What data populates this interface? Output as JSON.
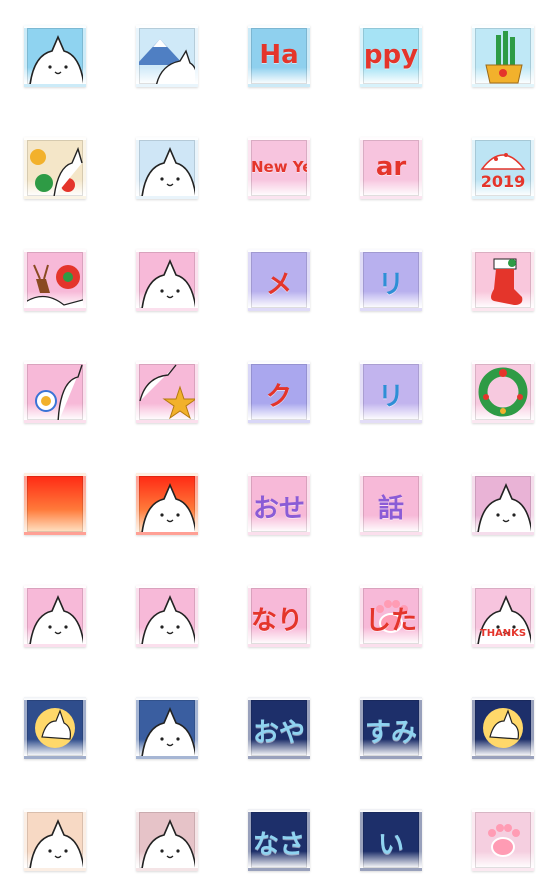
{
  "sheet": {
    "rows": [
      [
        {
          "name": "cat-sunrise-tile",
          "bg": "#8fd3f0",
          "icon": "cat-face-icon",
          "text": ""
        },
        {
          "name": "cat-mount-fuji-tile",
          "bg": "#cfe9f8",
          "icon": "mount-fuji-icon",
          "text": ""
        },
        {
          "name": "happy-ha-tile",
          "bg": "#8fd0ee",
          "icon": "",
          "text": "Ha"
        },
        {
          "name": "happy-ppy-tile",
          "bg": "#a6e3f5",
          "icon": "",
          "text": "ppy"
        },
        {
          "name": "kadomatsu-tile",
          "bg": "#bfe8f6",
          "icon": "kadomatsu-icon",
          "text": ""
        }
      ],
      [
        {
          "name": "cat-paint-tile",
          "bg": "#f4e6c8",
          "icon": "paint-splash-icon",
          "text": ""
        },
        {
          "name": "cat-paint-2-tile",
          "bg": "#cfe6f6",
          "icon": "cat-face-icon",
          "text": ""
        },
        {
          "name": "new-year-tile",
          "bg": "#f7c4de",
          "icon": "",
          "text": "New Ye"
        },
        {
          "name": "new-year-2-tile",
          "bg": "#f7c4de",
          "icon": "",
          "text": "ar"
        },
        {
          "name": "2019-tile",
          "bg": "#bde4f4",
          "icon": "fan-icon",
          "text": "2019"
        }
      ],
      [
        {
          "name": "reindeer-tile",
          "bg": "#f7b9d8",
          "icon": "reindeer-icon",
          "text": ""
        },
        {
          "name": "cat-christmas-tile",
          "bg": "#f7b9d8",
          "icon": "cat-face-icon",
          "text": ""
        },
        {
          "name": "merry-me-tile",
          "bg": "#b8b0ee",
          "icon": "",
          "text": "メ"
        },
        {
          "name": "merry-ri-tile",
          "bg": "#b8b0ee",
          "icon": "",
          "text": "リ"
        },
        {
          "name": "stocking-tile",
          "bg": "#f9c7dc",
          "icon": "stocking-icon",
          "text": ""
        }
      ],
      [
        {
          "name": "cat-ornament-tile",
          "bg": "#f7b9d8",
          "icon": "ornament-icon",
          "text": ""
        },
        {
          "name": "cat-star-tile",
          "bg": "#f7b9d8",
          "icon": "star-icon",
          "text": ""
        },
        {
          "name": "christmas-ku-tile",
          "bg": "#aaa7ee",
          "icon": "",
          "text": "ク"
        },
        {
          "name": "christmas-ri-tile",
          "bg": "#c2b4ee",
          "icon": "",
          "text": "リ"
        },
        {
          "name": "wreath-tile",
          "bg": "#f7c9df",
          "icon": "wreath-icon",
          "text": ""
        }
      ],
      [
        {
          "name": "sunrise-red-tile",
          "bg": "#ff3a1c",
          "icon": "",
          "text": ""
        },
        {
          "name": "sunrise-cat-tile",
          "bg": "#ff3a1c",
          "icon": "cat-face-icon",
          "text": ""
        },
        {
          "name": "thanks-ose-tile",
          "bg": "#f7b9d8",
          "icon": "",
          "text": "おせ"
        },
        {
          "name": "thanks-wa-tile",
          "bg": "#f7b9d8",
          "icon": "",
          "text": "話"
        },
        {
          "name": "cat-peek-tile",
          "bg": "#e9b3d6",
          "icon": "cat-face-icon",
          "text": ""
        }
      ],
      [
        {
          "name": "cat-bow-tile",
          "bg": "#f7b9d8",
          "icon": "cat-face-icon",
          "text": ""
        },
        {
          "name": "cat-bow-2-tile",
          "bg": "#f7b9d8",
          "icon": "cat-face-icon",
          "text": ""
        },
        {
          "name": "narima-tile",
          "bg": "#f7b9d8",
          "icon": "",
          "text": "なりま"
        },
        {
          "name": "shita-tile",
          "bg": "#f7b9d8",
          "icon": "paw-icon",
          "text": "した"
        },
        {
          "name": "thanks-tile",
          "bg": "#f7c4de",
          "icon": "cat-face-icon",
          "text": "THANKS"
        }
      ],
      [
        {
          "name": "moon-cat-tile",
          "bg": "#2f4d8c",
          "icon": "moon-icon",
          "text": ""
        },
        {
          "name": "night-cat-tile",
          "bg": "#3a5ea0",
          "icon": "cat-face-icon",
          "text": ""
        },
        {
          "name": "oya-tile",
          "bg": "#1d2f6a",
          "icon": "",
          "text": "おや"
        },
        {
          "name": "sumi-tile",
          "bg": "#1d2f6a",
          "icon": "",
          "text": "すみ"
        },
        {
          "name": "moon-cat-2-tile",
          "bg": "#1d2f6a",
          "icon": "moon-icon",
          "text": ""
        }
      ],
      [
        {
          "name": "sleep-cat-tile",
          "bg": "#f7d9c4",
          "icon": "cat-face-icon",
          "text": ""
        },
        {
          "name": "sleep-cat-2-tile",
          "bg": "#e6c3c8",
          "icon": "cat-face-icon",
          "text": ""
        },
        {
          "name": "nasa-tile",
          "bg": "#1d2f6a",
          "icon": "",
          "text": "なさ"
        },
        {
          "name": "i-tile",
          "bg": "#1d2f6a",
          "icon": "",
          "text": "い"
        },
        {
          "name": "paw-tile",
          "bg": "#f5cfe0",
          "icon": "paw-icon",
          "text": ""
        }
      ]
    ]
  },
  "colors": {
    "ink": "#222222",
    "red": "#e4352b",
    "green": "#2e9b45",
    "gold": "#f2b12c",
    "blue": "#3a73d6",
    "white": "#ffffff",
    "lilac": "#8b5cd6"
  }
}
